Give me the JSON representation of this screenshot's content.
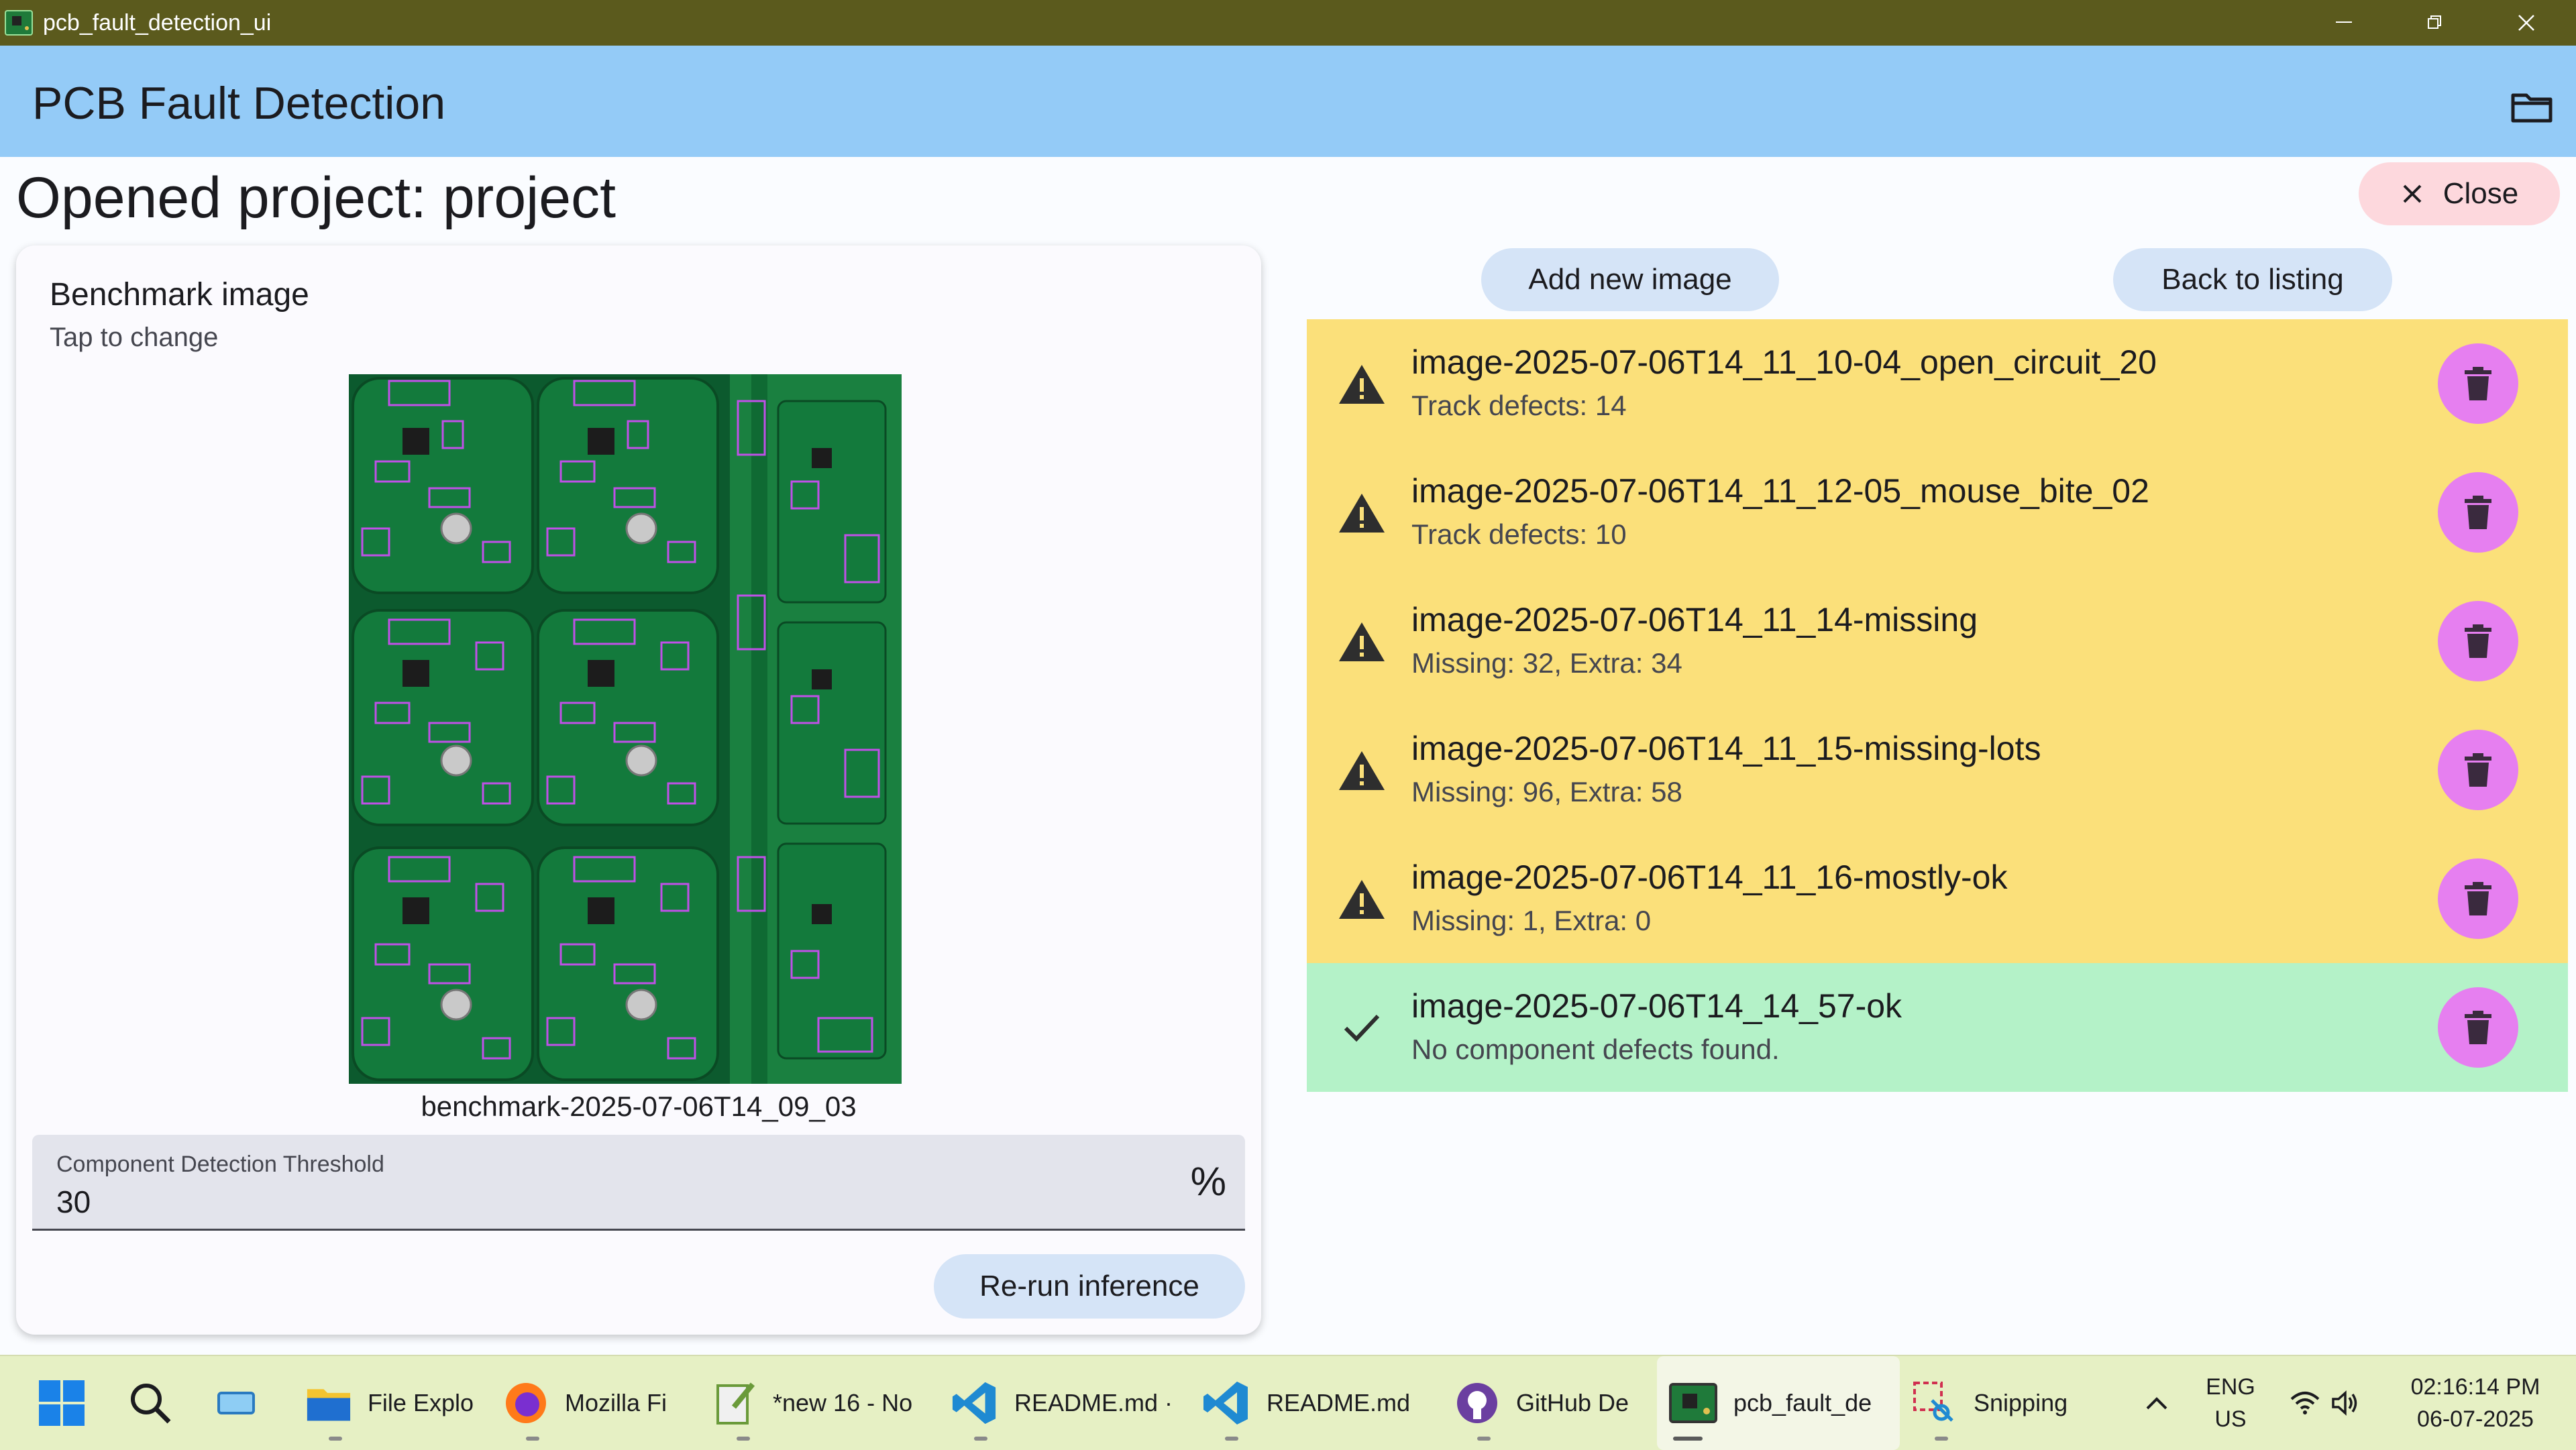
{
  "window": {
    "title": "pcb_fault_detection_ui"
  },
  "appbar": {
    "title": "PCB Fault Detection",
    "folder_icon": "folder-icon"
  },
  "project": {
    "heading": "Opened project: project",
    "close_label": "Close"
  },
  "benchmark": {
    "title": "Benchmark image",
    "subtitle": "Tap to change",
    "filename": "benchmark-2025-07-06T14_09_03",
    "threshold_label": "Component Detection Threshold",
    "threshold_value": "30",
    "threshold_suffix": "%",
    "rerun_label": "Re-run inference"
  },
  "actions": {
    "add_image_label": "Add new image",
    "back_label": "Back to listing"
  },
  "images": [
    {
      "title": "image-2025-07-06T14_11_10-04_open_circuit_20",
      "subtitle": "Track defects: 14",
      "status": "warning"
    },
    {
      "title": "image-2025-07-06T14_11_12-05_mouse_bite_02",
      "subtitle": "Track defects: 10",
      "status": "warning"
    },
    {
      "title": "image-2025-07-06T14_11_14-missing",
      "subtitle": "Missing: 32, Extra: 34",
      "status": "warning"
    },
    {
      "title": "image-2025-07-06T14_11_15-missing-lots",
      "subtitle": "Missing: 96, Extra: 58",
      "status": "warning"
    },
    {
      "title": "image-2025-07-06T14_11_16-mostly-ok",
      "subtitle": "Missing: 1, Extra: 0",
      "status": "warning"
    },
    {
      "title": "image-2025-07-06T14_14_57-ok",
      "subtitle": "No component defects found.",
      "status": "ok"
    }
  ],
  "colors": {
    "appbar": "#94cbf7",
    "warning_row": "#fbe07a",
    "ok_row": "#b4f2c8",
    "delete_button": "#e67ff0",
    "close_button": "#fdd8dd",
    "titlebar": "#5b5a1d",
    "taskbar": "#e6f0c4"
  },
  "taskbar": {
    "items": [
      {
        "label": "File Explo"
      },
      {
        "label": "Mozilla Fi"
      },
      {
        "label": "*new 16 - No"
      },
      {
        "label": "README.md ·"
      },
      {
        "label": "README.md"
      },
      {
        "label": "GitHub De"
      },
      {
        "label": "pcb_fault_de"
      },
      {
        "label": "Snipping"
      }
    ],
    "lang_top": "ENG",
    "lang_bottom": "US",
    "time": "02:16:14 PM",
    "date": "06-07-2025"
  }
}
